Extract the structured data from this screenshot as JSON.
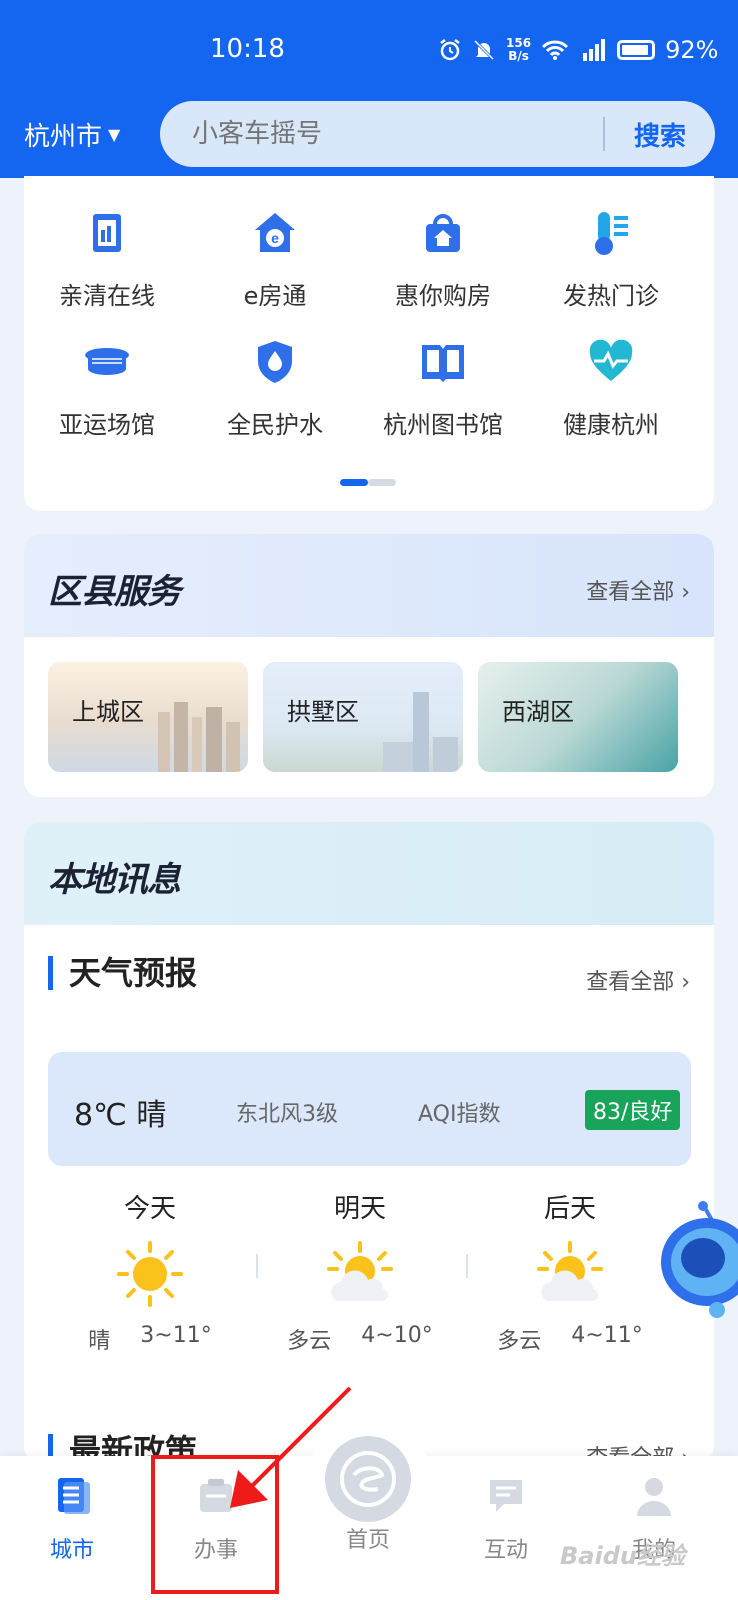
{
  "status_bar": {
    "time": "10:18",
    "net_speed_top": "156",
    "net_speed_bottom": "B/s",
    "battery": "92%"
  },
  "header": {
    "city": "杭州市",
    "search_placeholder": "小客车摇号",
    "search_button": "搜索"
  },
  "apps": [
    {
      "label": "亲清在线",
      "icon": "building-doc-icon"
    },
    {
      "label": "e房通",
      "icon": "e-house-icon"
    },
    {
      "label": "惠你购房",
      "icon": "shopping-house-icon"
    },
    {
      "label": "发热门诊",
      "icon": "thermometer-icon"
    },
    {
      "label": "亚运场馆",
      "icon": "stadium-icon"
    },
    {
      "label": "全民护水",
      "icon": "water-shield-icon"
    },
    {
      "label": "杭州图书馆",
      "icon": "book-icon"
    },
    {
      "label": "健康杭州",
      "icon": "heart-pulse-icon"
    }
  ],
  "district": {
    "title": "区县服务",
    "see_all": "查看全部 ›",
    "items": [
      "上城区",
      "拱墅区",
      "西湖区"
    ]
  },
  "news": {
    "title": "本地讯息"
  },
  "weather": {
    "title": "天气预报",
    "see_all": "查看全部 ›",
    "current": "8℃ 晴",
    "wind": "东北风3级",
    "aqi_label": "AQI指数",
    "aqi_value": "83/良好",
    "days": [
      {
        "name": "今天",
        "cond": "晴",
        "range": "3~11°",
        "icon": "sun-icon"
      },
      {
        "name": "明天",
        "cond": "多云",
        "range": "4~10°",
        "icon": "cloud-sun-icon"
      },
      {
        "name": "后天",
        "cond": "多云",
        "range": "4~11°",
        "icon": "cloud-sun-icon"
      }
    ]
  },
  "policy": {
    "title": "最新政策",
    "see_all": "查看全部 ›"
  },
  "nav": {
    "city": "城市",
    "affairs": "办事",
    "home": "首页",
    "interact": "互动",
    "mine": "我的"
  },
  "watermark": "Baidu经验",
  "colors": {
    "brand": "#1465f0",
    "aqi_good": "#1aa35a",
    "highlight": "#ef1b1b"
  }
}
